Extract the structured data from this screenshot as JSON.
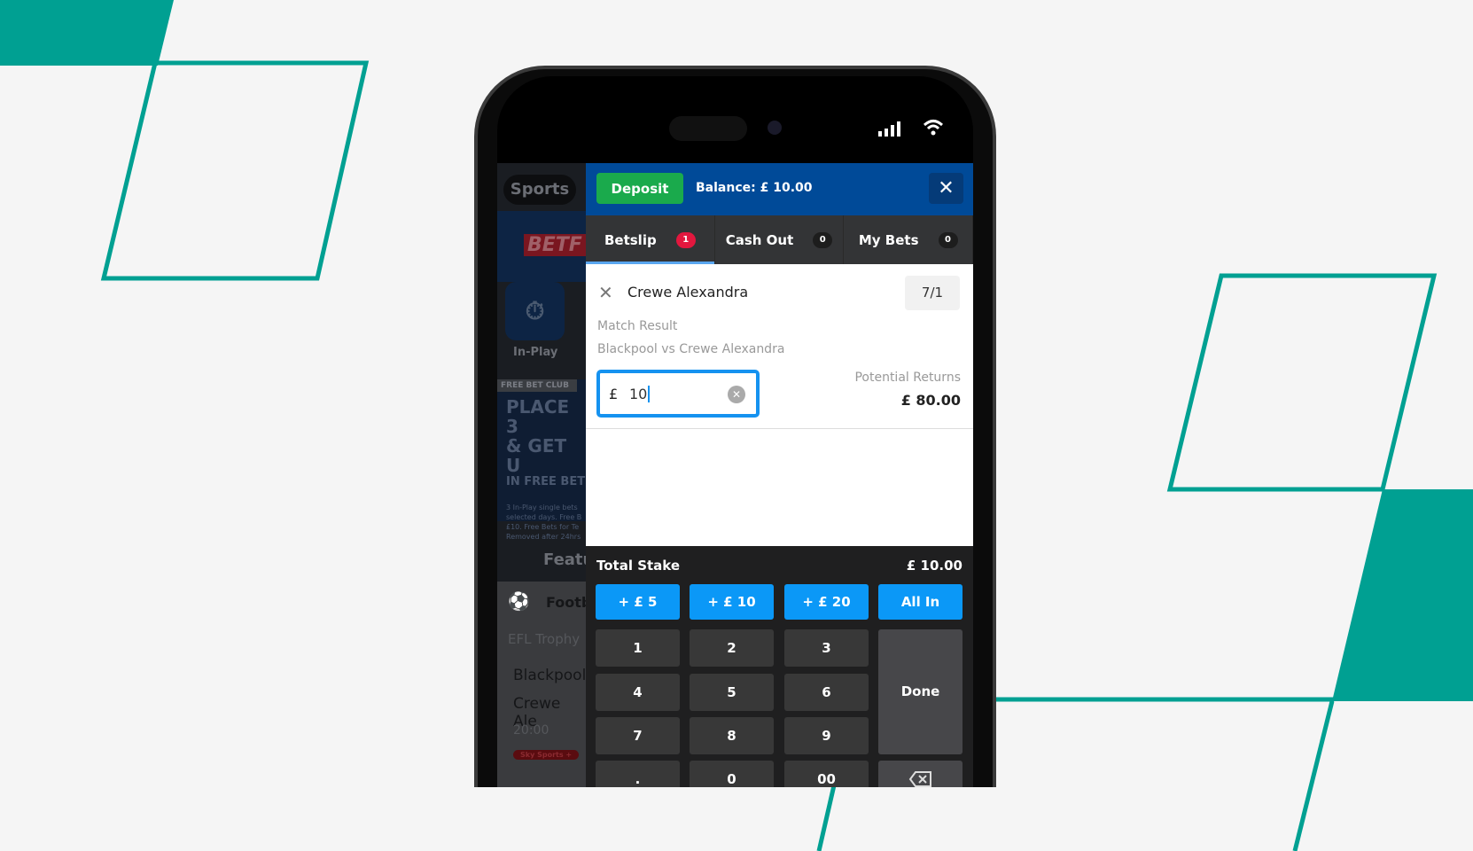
{
  "colors": {
    "teal": "#00a092",
    "deposit": "#1aaa4c",
    "header": "#004a98",
    "accent": "#0b98f7",
    "badge": "#e3173e"
  },
  "status_bar": {
    "icons": [
      "signal-icon",
      "wifi-icon"
    ]
  },
  "background_app": {
    "sports": "Sports",
    "logo": "BETF",
    "inplay": "In-Play",
    "promo_tag": "FREE BET CLUB",
    "promo_line1": "PLACE 3",
    "promo_line2": "& GET U",
    "promo_line3": "IN FREE BET",
    "promo_small": [
      "3 In-Play single bets",
      "selected days. Free B",
      "£10. Free Bets for Te",
      "Removed after 24hrs"
    ],
    "featured": "Featu",
    "sport": "Footb",
    "competition": "EFL Trophy",
    "team1": "Blackpool",
    "team2": "Crewe Ale",
    "time": "20:00",
    "channel": "Sky Sports +"
  },
  "header": {
    "deposit": "Deposit",
    "balance": "Balance: £ 10.00",
    "close": "✕"
  },
  "tabs": [
    {
      "label": "Betslip",
      "count": "1"
    },
    {
      "label": "Cash Out",
      "count": "0"
    },
    {
      "label": "My Bets",
      "count": "0"
    }
  ],
  "bet": {
    "selection": "Crewe Alexandra",
    "odds": "7/1",
    "market": "Match Result",
    "event": "Blackpool vs Crewe Alexandra",
    "currency": "£",
    "stake": "10",
    "returns_label": "Potential Returns",
    "returns": "£ 80.00"
  },
  "keypad": {
    "total_label": "Total Stake",
    "total": "£ 10.00",
    "quick": [
      "+ £ 5",
      "+ £ 10",
      "+ £ 20",
      "All In"
    ],
    "keys": [
      "1",
      "2",
      "3",
      "4",
      "5",
      "6",
      "7",
      "8",
      "9",
      ".",
      "0",
      "00"
    ],
    "done": "Done"
  }
}
